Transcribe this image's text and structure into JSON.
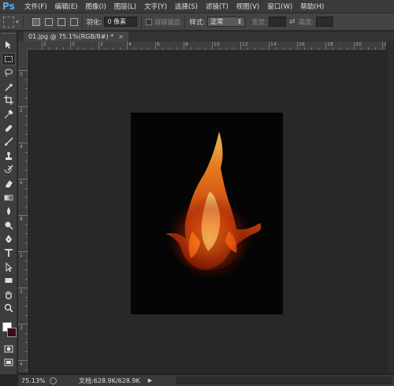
{
  "app": {
    "logo": "Ps"
  },
  "menu": {
    "items": [
      "文件(F)",
      "编辑(E)",
      "图像(I)",
      "图层(L)",
      "文字(Y)",
      "选择(S)",
      "滤镜(T)",
      "视图(V)",
      "窗口(W)",
      "帮助(H)"
    ]
  },
  "options": {
    "feather_label": "羽化:",
    "feather_value": "0 像素",
    "antialias_label": "消除锯齿",
    "style_label": "样式:",
    "style_value": "正常",
    "width_label": "宽度:",
    "height_label": "高度:",
    "swap_glyph": "⇄"
  },
  "document": {
    "tab_title": "01.jpg @ 75.1%(RGB/8#) *",
    "close_glyph": "×"
  },
  "ruler": {
    "top": [
      "2",
      "0",
      "2",
      "4",
      "6",
      "8",
      "10",
      "12",
      "14",
      "16",
      "18",
      "20",
      "22"
    ],
    "left": [
      "0",
      "2",
      "4",
      "6",
      "8",
      "1",
      "2",
      "3",
      "4",
      "5"
    ]
  },
  "status": {
    "zoom": "75.13%",
    "doc_info": "文档:628.9K/628.9K",
    "arrow": "▶"
  },
  "colors": {
    "foreground": "#ffffff",
    "background": "#3a0a16",
    "accent": "#5aa9ee"
  },
  "tools": [
    "move-tool-icon",
    "marquee-tool-icon",
    "lasso-tool-icon",
    "magic-wand-icon",
    "crop-tool-icon",
    "eyedropper-icon",
    "healing-brush-icon",
    "brush-tool-icon",
    "clone-stamp-icon",
    "history-brush-icon",
    "eraser-icon",
    "gradient-tool-icon",
    "blur-tool-icon",
    "dodge-tool-icon",
    "pen-tool-icon",
    "type-tool-icon",
    "path-selection-icon",
    "shape-tool-icon",
    "hand-tool-icon",
    "zoom-tool-icon"
  ]
}
